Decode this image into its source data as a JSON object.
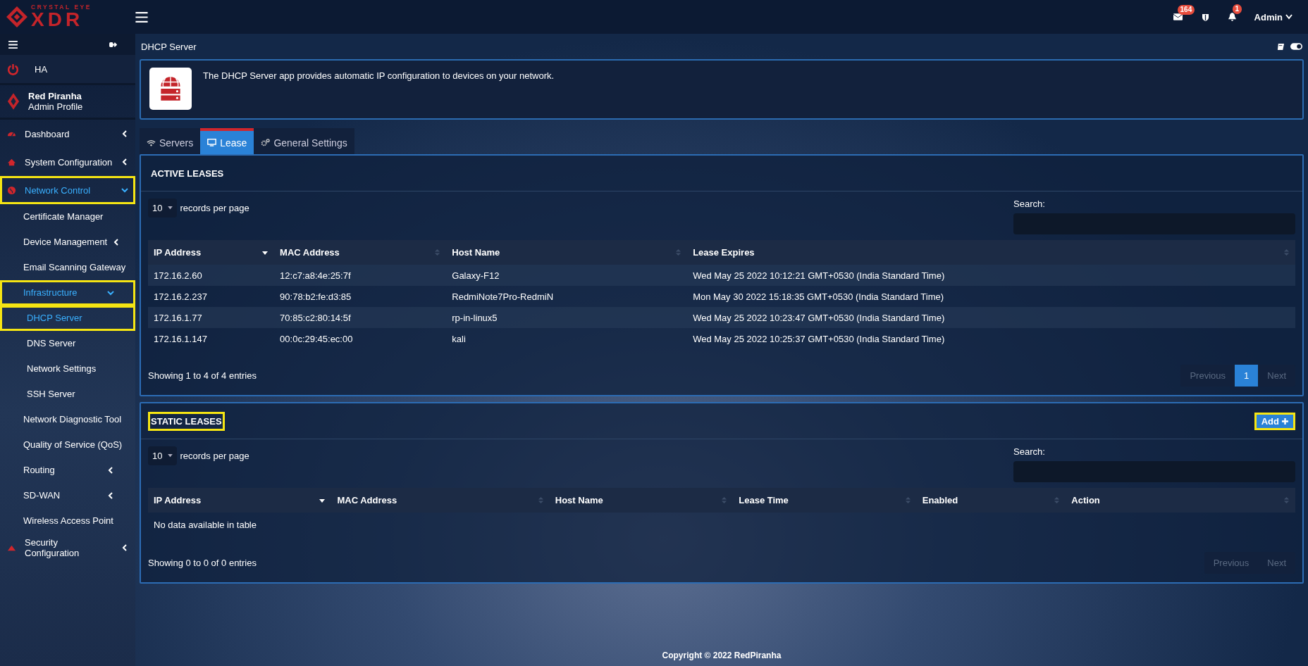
{
  "header": {
    "logo_small": "CRYSTAL EYE",
    "logo_large": "XDR",
    "mail_count": "164",
    "alert_count": "1",
    "user": "Admin"
  },
  "sidebar": {
    "ha_label": "HA",
    "profile": {
      "name": "Red Piranha",
      "role": "Admin Profile"
    },
    "items": [
      {
        "label": "Dashboard",
        "selected": false,
        "expanded": false,
        "highlighted": false
      },
      {
        "label": "System Configuration",
        "selected": false,
        "expanded": false,
        "highlighted": false
      },
      {
        "label": "Network Control",
        "selected": true,
        "expanded": true,
        "highlighted": true,
        "children": [
          {
            "label": "Certificate Manager",
            "selected": false,
            "highlighted": false
          },
          {
            "label": "Device Management",
            "selected": false,
            "expanded": false,
            "highlighted": false
          },
          {
            "label": "Email Scanning Gateway",
            "selected": false,
            "highlighted": false
          },
          {
            "label": "Infrastructure",
            "selected": true,
            "expanded": true,
            "highlighted": true,
            "children": [
              {
                "label": "DHCP Server",
                "selected": true,
                "highlighted": true
              },
              {
                "label": "DNS Server",
                "selected": false,
                "highlighted": false
              },
              {
                "label": "Network Settings",
                "selected": false,
                "highlighted": false
              },
              {
                "label": "SSH Server",
                "selected": false,
                "highlighted": false
              }
            ]
          },
          {
            "label": "Network Diagnostic Tool",
            "selected": false,
            "highlighted": false
          },
          {
            "label": "Quality of Service (QoS)",
            "selected": false,
            "highlighted": false
          },
          {
            "label": "Routing",
            "selected": false,
            "expanded": false,
            "highlighted": false
          },
          {
            "label": "SD-WAN",
            "selected": false,
            "expanded": false,
            "highlighted": false
          },
          {
            "label": "Wireless Access Point",
            "selected": false,
            "highlighted": false
          }
        ]
      },
      {
        "label": "Security Configuration",
        "selected": false,
        "expanded": false,
        "highlighted": false
      }
    ]
  },
  "page_title": "DHCP Server",
  "intro": "The DHCP Server app provides automatic IP configuration to devices on your network.",
  "tabs": [
    {
      "label": "Servers",
      "selected": false
    },
    {
      "label": "Lease",
      "selected": true
    },
    {
      "label": "General Settings",
      "selected": false
    }
  ],
  "active_leases": {
    "title": "ACTIVE LEASES",
    "highlighted": false,
    "page_size": "10",
    "page_size_label": "records per page",
    "search_label": "Search:",
    "columns": [
      {
        "label": "IP Address",
        "sorted": true
      },
      {
        "label": "MAC Address",
        "sorted": false
      },
      {
        "label": "Host Name",
        "sorted": false
      },
      {
        "label": "Lease Expires",
        "sorted": false
      }
    ],
    "rows": [
      [
        "172.16.2.60",
        "12:c7:a8:4e:25:7f",
        "Galaxy-F12",
        "Wed May 25 2022 10:12:21 GMT+0530 (India Standard Time)"
      ],
      [
        "172.16.2.237",
        "90:78:b2:fe:d3:85",
        "RedmiNote7Pro-RedmiN",
        "Mon May 30 2022 15:18:35 GMT+0530 (India Standard Time)"
      ],
      [
        "172.16.1.77",
        "70:85:c2:80:14:5f",
        "rp-in-linux5",
        "Wed May 25 2022 10:23:47 GMT+0530 (India Standard Time)"
      ],
      [
        "172.16.1.147",
        "00:0c:29:45:ec:00",
        "kali",
        "Wed May 25 2022 10:25:37 GMT+0530 (India Standard Time)"
      ]
    ],
    "info": "Showing 1 to 4 of 4 entries",
    "pagination": [
      {
        "label": "Previous",
        "selected": false,
        "disabled": true
      },
      {
        "label": "1",
        "selected": true,
        "disabled": false
      },
      {
        "label": "Next",
        "selected": false,
        "disabled": true
      }
    ]
  },
  "static_leases": {
    "title": "STATIC LEASES",
    "highlighted": true,
    "add_button": {
      "label": "Add",
      "highlighted": true
    },
    "page_size": "10",
    "page_size_label": "records per page",
    "search_label": "Search:",
    "columns": [
      {
        "label": "IP Address",
        "sorted": true
      },
      {
        "label": "MAC Address",
        "sorted": false
      },
      {
        "label": "Host Name",
        "sorted": false
      },
      {
        "label": "Lease Time",
        "sorted": false
      },
      {
        "label": "Enabled",
        "sorted": false
      },
      {
        "label": "Action",
        "sorted": false
      }
    ],
    "empty": "No data available in table",
    "info": "Showing 0 to 0 of 0 entries",
    "pagination": [
      {
        "label": "Previous",
        "selected": false,
        "disabled": true
      },
      {
        "label": "Next",
        "selected": false,
        "disabled": true
      }
    ]
  },
  "footer": "Copyright © 2022 RedPiranha"
}
